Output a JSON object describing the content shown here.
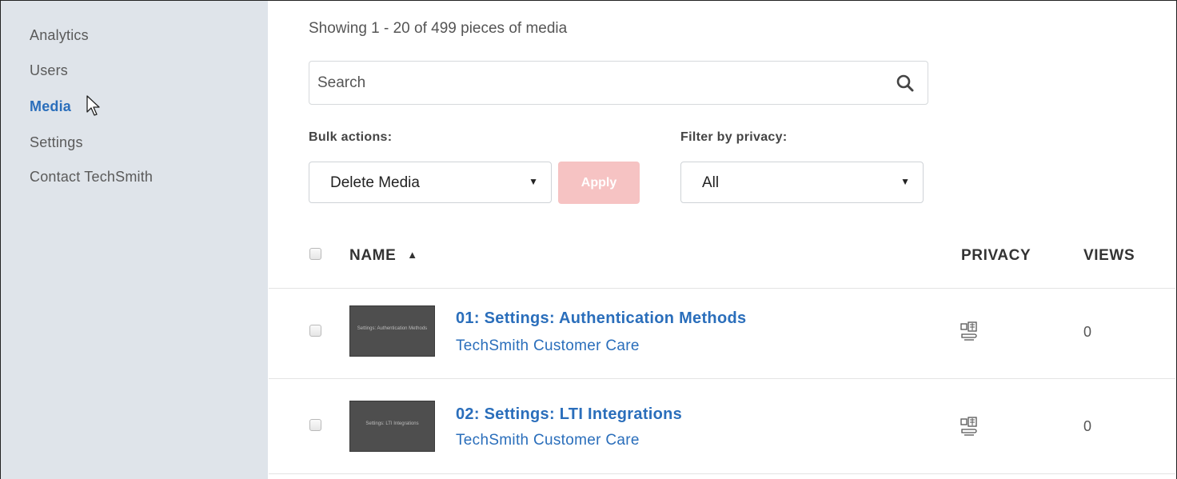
{
  "sidebar": {
    "items": [
      {
        "label": "Analytics"
      },
      {
        "label": "Users"
      },
      {
        "label": "Media"
      },
      {
        "label": "Settings"
      },
      {
        "label": "Contact TechSmith"
      }
    ],
    "active": "Media"
  },
  "main": {
    "showing_text": "Showing 1 - 20 of 499 pieces of media",
    "search": {
      "placeholder": "Search",
      "value": ""
    },
    "bulk_actions": {
      "label": "Bulk actions:",
      "selected": "Delete Media",
      "apply_label": "Apply"
    },
    "filter_privacy": {
      "label": "Filter by privacy:",
      "selected": "All"
    },
    "table": {
      "headers": {
        "name": "NAME",
        "sort_indicator": "▲",
        "privacy": "PRIVACY",
        "views": "VIEWS"
      },
      "rows": [
        {
          "title": "01: Settings: Authentication Methods",
          "owner": "TechSmith Customer Care",
          "thumbnail_text": "Settings: Authentication Methods",
          "privacy_icon": "organization-icon",
          "views": "0"
        },
        {
          "title": "02: Settings: LTI Integrations",
          "owner": "TechSmith Customer Care",
          "thumbnail_text": "Settings: LTI Integrations",
          "privacy_icon": "organization-icon",
          "views": "0"
        }
      ]
    }
  },
  "colors": {
    "sidebar_bg": "#dfe4ea",
    "accent": "#2a6ebb",
    "apply_disabled": "#f6c3c3"
  }
}
